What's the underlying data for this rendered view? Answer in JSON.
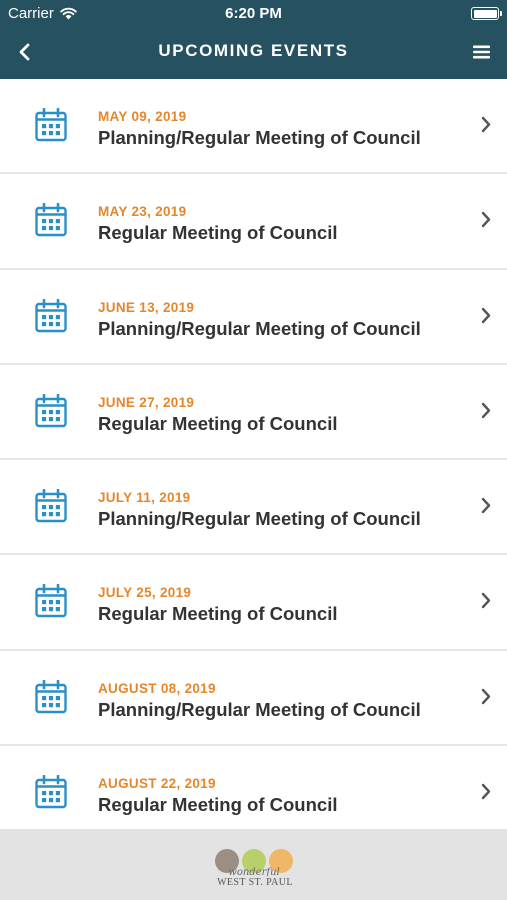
{
  "status_bar": {
    "carrier": "Carrier",
    "time": "6:20 PM"
  },
  "header": {
    "title": "UPCOMING EVENTS"
  },
  "events": [
    {
      "date": "MAY 09, 2019",
      "title": "Planning/Regular Meeting of Council"
    },
    {
      "date": "MAY 23, 2019",
      "title": "Regular Meeting of Council"
    },
    {
      "date": "JUNE 13, 2019",
      "title": "Planning/Regular Meeting of Council"
    },
    {
      "date": "JUNE 27, 2019",
      "title": "Regular Meeting of Council"
    },
    {
      "date": "JULY 11, 2019",
      "title": "Planning/Regular Meeting of Council"
    },
    {
      "date": "JULY 25, 2019",
      "title": "Regular Meeting of Council"
    },
    {
      "date": "AUGUST 08, 2019",
      "title": "Planning/Regular Meeting of Council"
    },
    {
      "date": "AUGUST 22, 2019",
      "title": "Regular Meeting of Council"
    }
  ],
  "footer": {
    "logo_text": "WEST ST. PAUL",
    "logo_script": "wonderful"
  },
  "colors": {
    "header_bg": "#265160",
    "date_accent": "#e6862a",
    "icon_blue": "#2b8fc7",
    "footer_bg": "#e3e3e3"
  },
  "icons": {
    "back": "chevron-left-icon",
    "menu": "hamburger-menu-icon",
    "event": "calendar-icon",
    "row_arrow": "chevron-right-icon"
  }
}
